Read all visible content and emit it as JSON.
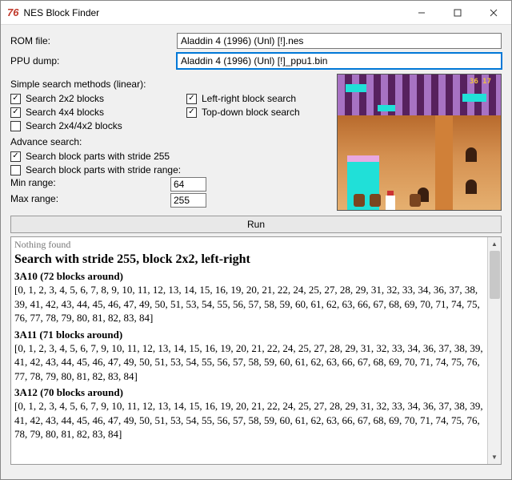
{
  "window": {
    "app_icon_text": "76",
    "title": "NES Block Finder"
  },
  "form": {
    "rom_label": "ROM file:",
    "rom_value": "Aladdin 4 (1996) (Unl) [!].nes",
    "ppu_label": "PPU dump:",
    "ppu_value": "Aladdin 4 (1996) (Unl) [!]_ppu1.bin"
  },
  "simple_heading": "Simple search methods (linear):",
  "checks": {
    "c2x2": {
      "label": "Search 2x2 blocks",
      "checked": true
    },
    "c4x4": {
      "label": "Search 4x4 blocks",
      "checked": true
    },
    "c2x4": {
      "label": "Search 2x4/4x2 blocks",
      "checked": false
    },
    "clr": {
      "label": "Left-right block search",
      "checked": true
    },
    "ctd": {
      "label": "Top-down block search",
      "checked": true
    }
  },
  "advance_heading": "Advance search:",
  "adv": {
    "stride255": {
      "label": "Search block parts with stride 255",
      "checked": true
    },
    "stride_range": {
      "label": "Search block parts with stride range:",
      "checked": false
    },
    "min_label": "Min range:",
    "min_value": "64",
    "max_label": "Max range:",
    "max_value": "255"
  },
  "run_label": "Run",
  "preview": {
    "score": "36 17"
  },
  "results": {
    "cutoff": "Nothing found",
    "header": "Search with stride 255, block 2x2, left-right",
    "blocks": [
      {
        "title": "3A10 (72 blocks around)",
        "array": "[0, 1, 2, 3, 4, 5, 6, 7, 8, 9, 10, 11, 12, 13, 14, 15, 16, 19, 20, 21, 22, 24, 25, 27, 28, 29, 31, 32, 33, 34, 36, 37, 38, 39, 41, 42, 43, 44, 45, 46, 47, 49, 50, 51, 53, 54, 55, 56, 57, 58, 59, 60, 61, 62, 63, 66, 67, 68, 69, 70, 71, 74, 75, 76, 77, 78, 79, 80, 81, 82, 83, 84]"
      },
      {
        "title": "3A11 (71 blocks around)",
        "array": "[0, 1, 2, 3, 4, 5, 6, 7, 9, 10, 11, 12, 13, 14, 15, 16, 19, 20, 21, 22, 24, 25, 27, 28, 29, 31, 32, 33, 34, 36, 37, 38, 39, 41, 42, 43, 44, 45, 46, 47, 49, 50, 51, 53, 54, 55, 56, 57, 58, 59, 60, 61, 62, 63, 66, 67, 68, 69, 70, 71, 74, 75, 76, 77, 78, 79, 80, 81, 82, 83, 84]"
      },
      {
        "title": "3A12 (70 blocks around)",
        "array": "[0, 1, 2, 3, 4, 5, 6, 7, 9, 10, 11, 12, 13, 14, 15, 16, 19, 20, 21, 22, 24, 25, 27, 28, 29, 31, 32, 33, 34, 36, 37, 38, 39, 41, 42, 43, 44, 45, 46, 47, 49, 50, 51, 53, 54, 55, 56, 57, 58, 59, 60, 61, 62, 63, 66, 67, 68, 69, 70, 71, 74, 75, 76, 78, 79, 80, 81, 82, 83, 84]"
      }
    ]
  }
}
